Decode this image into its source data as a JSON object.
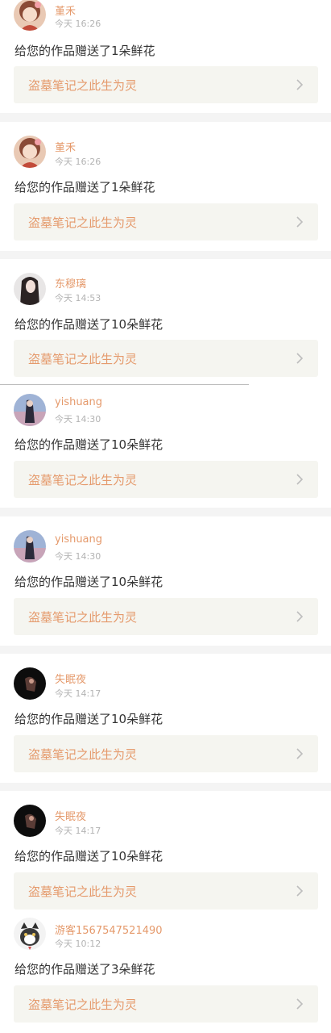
{
  "notifications": [
    {
      "user": "堇禾",
      "time": "今天 16:26",
      "message": "给您的作品赠送了1朵鲜花",
      "work_title": "盗墓笔记之此生为灵",
      "avatar_icon": "anime-girl-avatar-icon"
    },
    {
      "user": "堇禾",
      "time": "今天 16:26",
      "message": "给您的作品赠送了1朵鲜花",
      "work_title": "盗墓笔记之此生为灵",
      "avatar_icon": "anime-girl-avatar-icon"
    },
    {
      "user": "东穆璃",
      "time": "今天 14:53",
      "message": "给您的作品赠送了10朵鲜花",
      "work_title": "盗墓笔记之此生为灵",
      "avatar_icon": "portrait-avatar-icon"
    },
    {
      "user": "yishuang",
      "time": "今天 14:30",
      "message": "给您的作品赠送了10朵鲜花",
      "work_title": "盗墓笔记之此生为灵",
      "avatar_icon": "seaside-avatar-icon"
    },
    {
      "user": "yishuang",
      "time": "今天 14:30",
      "message": "给您的作品赠送了10朵鲜花",
      "work_title": "盗墓笔记之此生为灵",
      "avatar_icon": "seaside-avatar-icon"
    },
    {
      "user": "失眠夜",
      "time": "今天 14:17",
      "message": "给您的作品赠送了10朵鲜花",
      "work_title": "盗墓笔记之此生为灵",
      "avatar_icon": "dark-figure-avatar-icon"
    },
    {
      "user": "失眠夜",
      "time": "今天 14:17",
      "message": "给您的作品赠送了10朵鲜花",
      "work_title": "盗墓笔记之此生为灵",
      "avatar_icon": "dark-figure-avatar-icon"
    },
    {
      "user": "游客1567547521490",
      "time": "今天 10:12",
      "message": "给您的作品赠送了3朵鲜花",
      "work_title": "盗墓笔记之此生为灵",
      "avatar_icon": "cat-avatar-icon"
    }
  ],
  "colors": {
    "username": "#e59a6c",
    "work_title": "#e59a6c",
    "time": "#b3b3b3",
    "message": "#333333",
    "work_bg": "#f5f5f0",
    "page_bg": "#f4f4f4"
  },
  "icons": {
    "chevron": "chevron-right-icon"
  }
}
